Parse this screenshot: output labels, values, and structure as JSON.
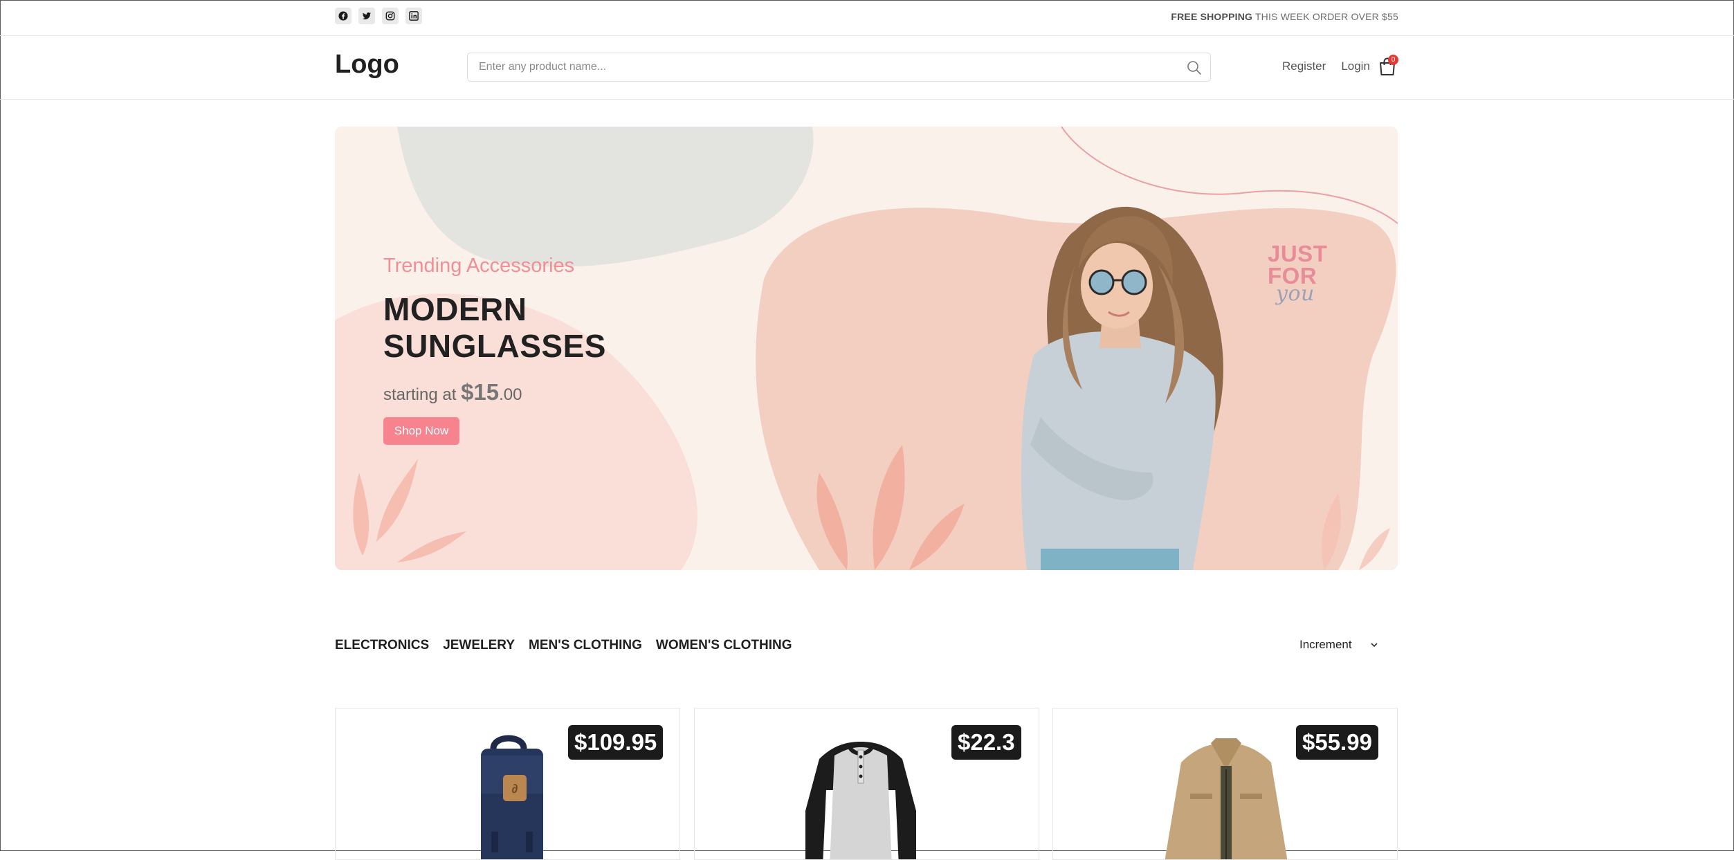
{
  "topbar": {
    "socials": [
      {
        "icon": "facebook-icon"
      },
      {
        "icon": "twitter-icon"
      },
      {
        "icon": "instagram-icon"
      },
      {
        "icon": "linkedin-icon"
      }
    ],
    "promo_bold": "FREE SHOPPING",
    "promo_text": " THIS WEEK ORDER OVER $55"
  },
  "header": {
    "logo": "Logo",
    "search_placeholder": "Enter any product name...",
    "register": "Register",
    "login": "Login",
    "cart_count": "0"
  },
  "hero": {
    "subtitle": "Trending Accessories",
    "title": "MODERN SUNGLASSES",
    "price_prefix": "starting at ",
    "price_whole": "$15",
    "price_cents": ".00",
    "button": "Shop Now",
    "badge_top": "JUST",
    "badge_middle": "FOR",
    "badge_script": "you"
  },
  "categories": [
    "ELECTRONICS",
    "JEWELERY",
    "MEN'S CLOTHING",
    "WOMEN'S CLOTHING"
  ],
  "sort": {
    "selected": "Increment"
  },
  "products": [
    {
      "price": "$109.95",
      "image": "backpack"
    },
    {
      "price": "$22.3",
      "image": "raglan-shirt"
    },
    {
      "price": "$55.99",
      "image": "jacket"
    }
  ],
  "colors": {
    "accent": "#f7838e",
    "hero_bg": "#faf1ea",
    "price_tag": "#1b1b1b",
    "badge": "#e53935"
  }
}
